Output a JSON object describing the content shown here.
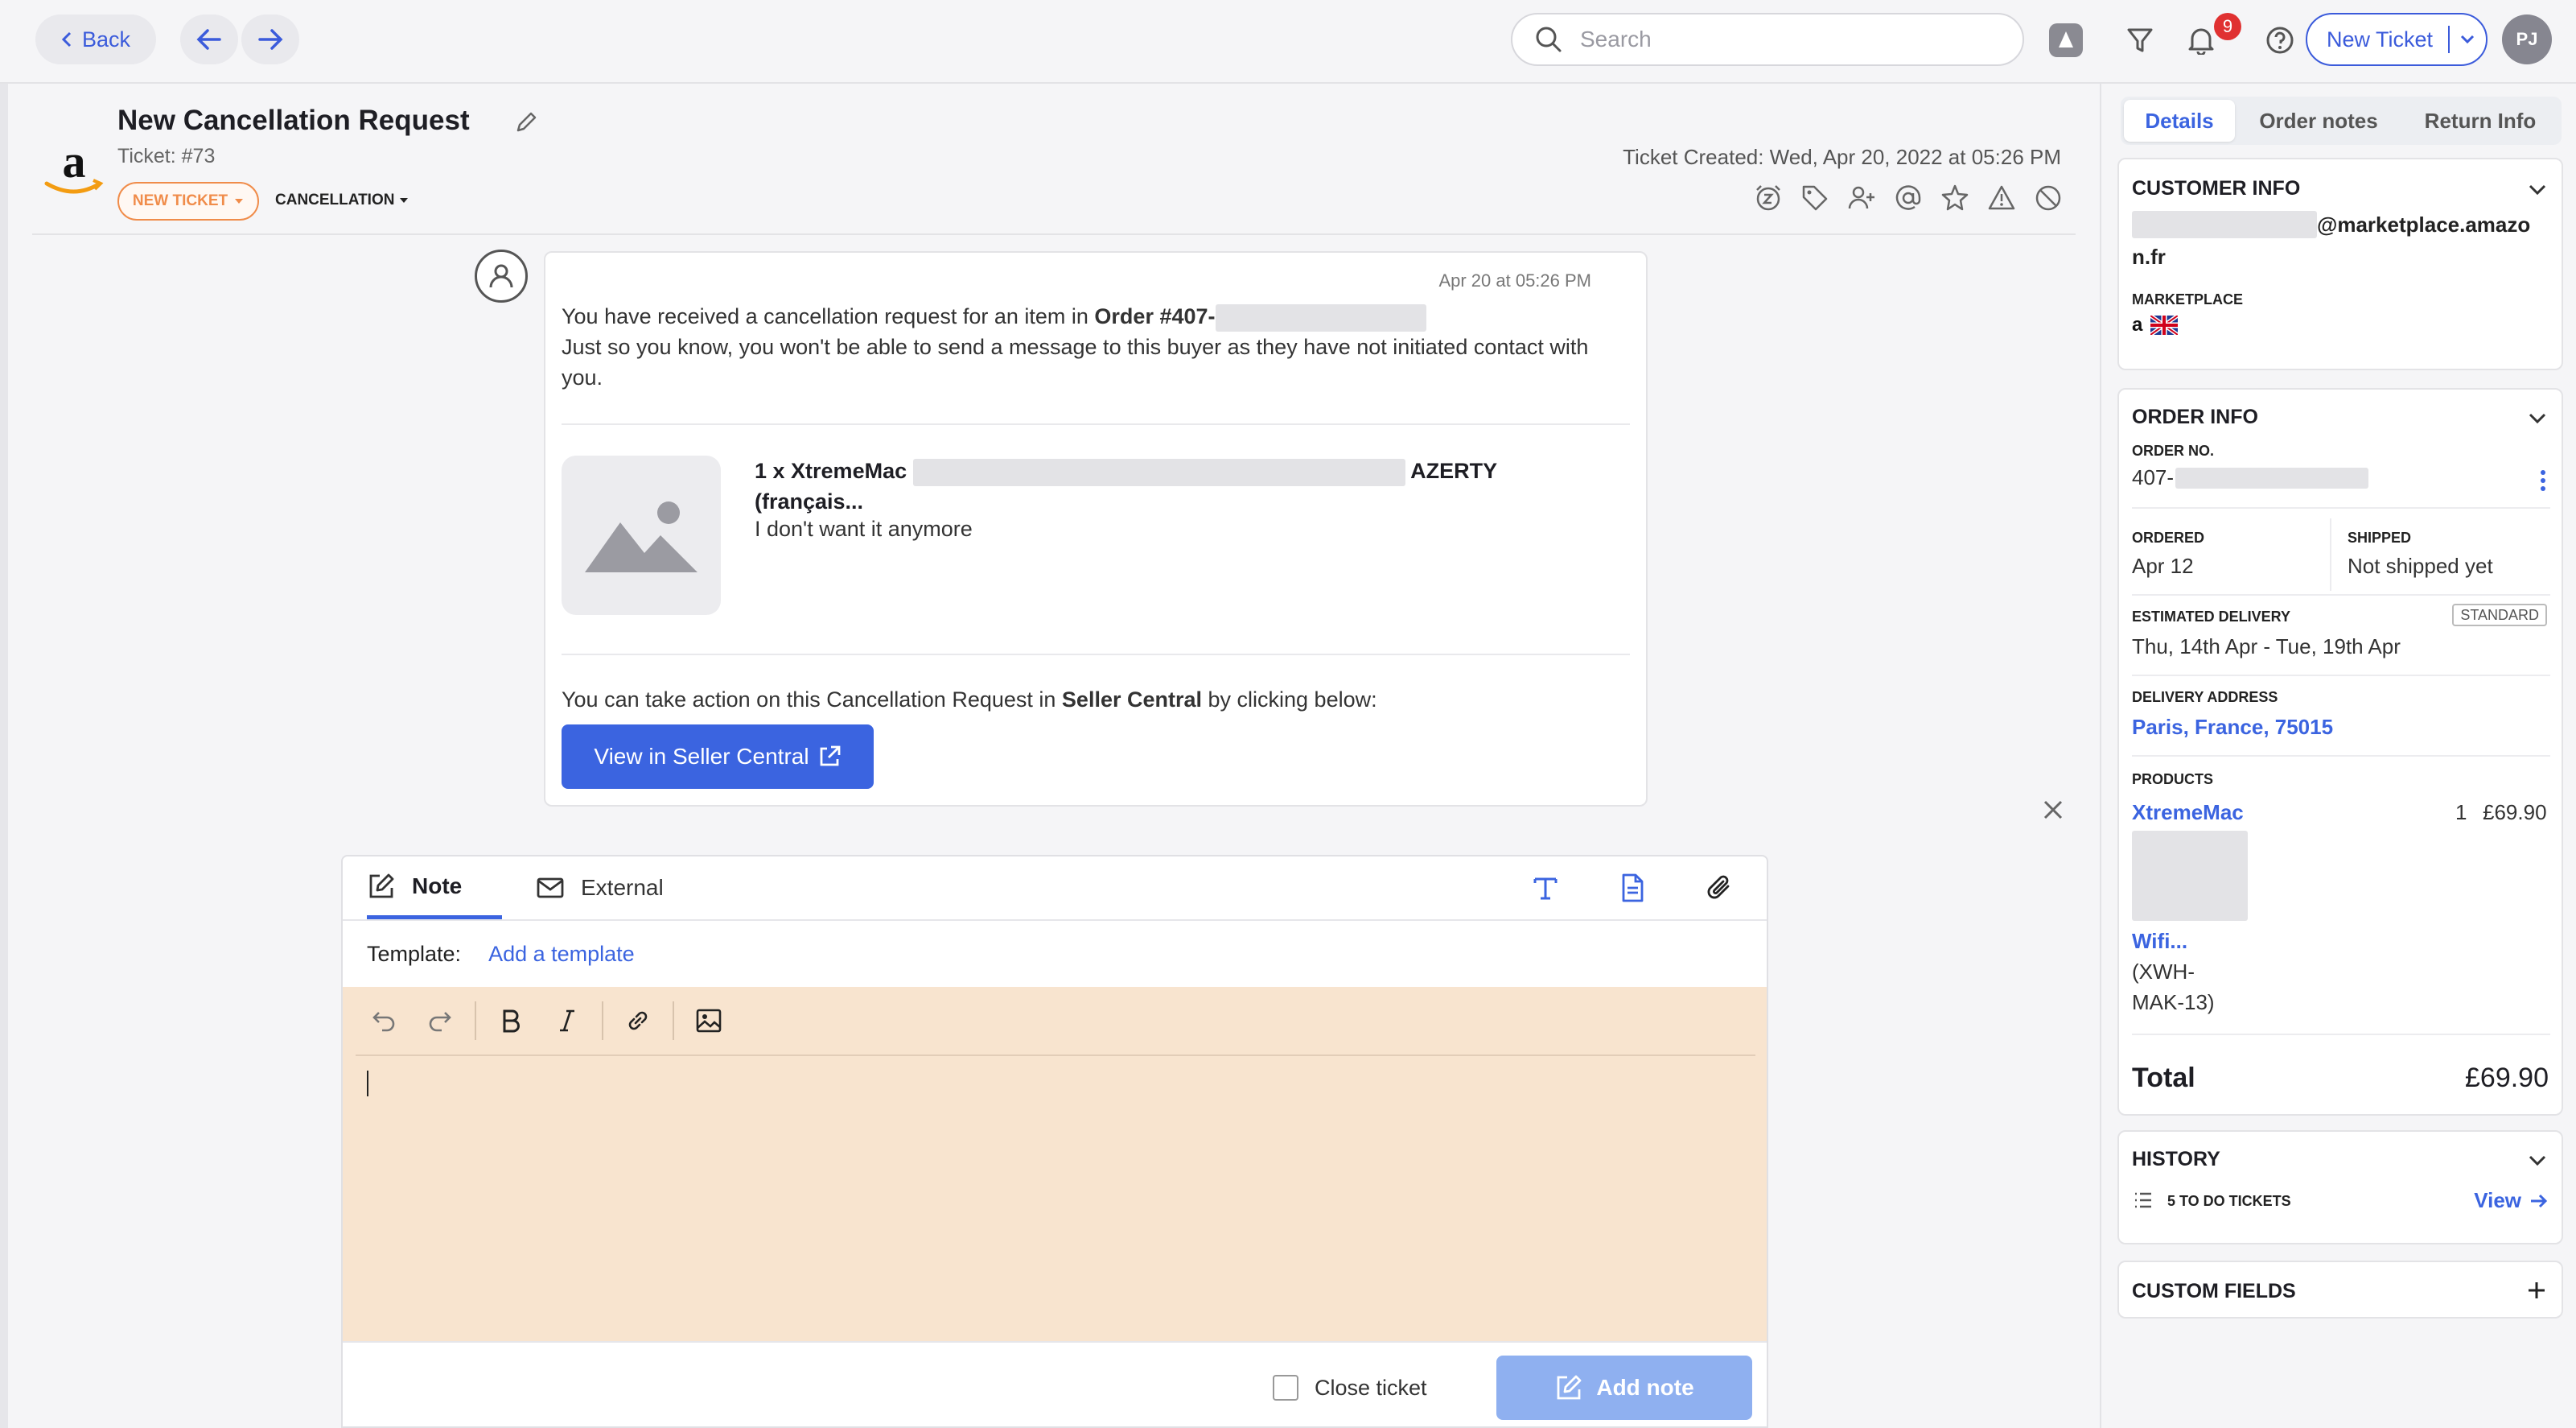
{
  "topbar": {
    "back_label": "Back",
    "search_placeholder": "Search",
    "notification_count": "9",
    "new_ticket_label": "New Ticket",
    "avatar_initials": "PJ"
  },
  "ticket": {
    "title": "New Cancellation Request",
    "number": "Ticket: #73",
    "status_pill": "NEW TICKET",
    "category_tag": "CANCELLATION",
    "created": "Ticket Created: Wed, Apr 20, 2022 at 05:26 PM"
  },
  "message": {
    "time": "Apr 20 at 05:26 PM",
    "line1_prefix": "You have received a cancellation request for an item in ",
    "order_bold": "Order #407-",
    "line2": "Just so you know, you won't be able to send a message to this buyer as they have not initiated contact with you.",
    "product_prefix": "1 x XtremeMac",
    "product_suffix": "AZERTY",
    "product_line2": "(français...",
    "reason": "I don't want it anymore",
    "action_prefix": "You can take action on this Cancellation Request in ",
    "action_bold": "Seller Central",
    "action_suffix": " by clicking below:",
    "button_label": "View in Seller Central"
  },
  "composer": {
    "tab_note": "Note",
    "tab_external": "External",
    "template_label": "Template:",
    "template_link": "Add a template",
    "close_ticket_label": "Close ticket",
    "add_note_label": "Add note"
  },
  "sidebar": {
    "tabs": [
      "Details",
      "Order notes",
      "Return Info"
    ],
    "customer_info": {
      "heading": "CUSTOMER INFO",
      "email_part1": "@marketplace.amazo",
      "email_part2": "n.fr",
      "marketplace_label": "MARKETPLACE",
      "marketplace_logo": "a"
    },
    "order_info": {
      "heading": "ORDER INFO",
      "order_no_label": "ORDER NO.",
      "order_no": "407-",
      "ordered_label": "ORDERED",
      "ordered": "Apr 12",
      "shipped_label": "SHIPPED",
      "shipped": "Not shipped yet",
      "est_delivery_label": "ESTIMATED DELIVERY",
      "est_delivery_badge": "STANDARD",
      "est_delivery": "Thu, 14th Apr - Tue, 19th Apr",
      "delivery_address_label": "DELIVERY ADDRESS",
      "delivery_address": "Paris, France, 75015",
      "products_label": "PRODUCTS",
      "product_name": "XtremeMac",
      "product_qty": "1",
      "product_price": "£69.90",
      "product_name2": "Wifi...",
      "product_sku1": "(XWH-",
      "product_sku2": "MAK-13)",
      "total_label": "Total",
      "total_value": "£69.90"
    },
    "history": {
      "heading": "HISTORY",
      "todo": "5 TO DO TICKETS",
      "view_link": "View"
    },
    "custom_fields": {
      "heading": "CUSTOM FIELDS"
    }
  }
}
